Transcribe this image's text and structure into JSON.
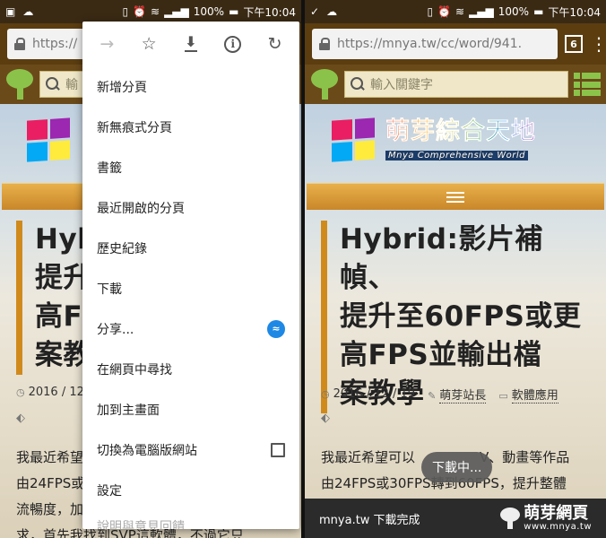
{
  "status_bar": {
    "battery": "100%",
    "time": "下午10:04"
  },
  "left": {
    "url_text": "https://",
    "search_placeholder": "輸",
    "article_title_lines": [
      "Hyb",
      "提升",
      "高F",
      "案教"
    ],
    "meta_date": "2016 / 12",
    "body_lines": [
      "我最近希望",
      "由24FPS或",
      "流暢度，加",
      "求，首先我找到SVP這軟體，不過它只"
    ],
    "menu": {
      "icons": [
        "forward-icon",
        "star-icon",
        "download-icon",
        "info-icon",
        "reload-icon"
      ],
      "items": [
        {
          "label": "新增分頁"
        },
        {
          "label": "新無痕式分頁"
        },
        {
          "label": "書籤"
        },
        {
          "label": "最近開啟的分頁"
        },
        {
          "label": "歷史紀錄"
        },
        {
          "label": "下載"
        },
        {
          "label": "分享..."
        },
        {
          "label": "在網頁中尋找"
        },
        {
          "label": "加到主畫面"
        },
        {
          "label": "切換為電腦版網站"
        },
        {
          "label": "設定"
        },
        {
          "label": "說明與意見回饋"
        }
      ]
    }
  },
  "right": {
    "url_text": "https://mnya.tw/cc/word/941.",
    "tab_count": "6",
    "search_placeholder": "輸入關鍵字",
    "site_title": "萌芽綜合天地",
    "site_subtitle": "Mnya Comprehensive World",
    "article_title_lines": [
      "Hybrid:影片補幀、",
      "提升至60FPS或更",
      "高FPS並輸出檔",
      "案教學"
    ],
    "meta_date": "2016 / 12 / 19",
    "meta_author": "萌芽站長",
    "meta_category": "軟體應用",
    "body_lines": [
      "我最近希望可以",
      "V、動畫等作品",
      "由24FPS或30FPS轉到60FPS，提升整體"
    ],
    "toast": "下載中...",
    "download_complete": "mnya.tw 下載完成",
    "watermark_name": "萌芽網頁",
    "watermark_url": "www.mnya.tw"
  },
  "colors": {
    "url_bar": "#5b3d10",
    "site_bar": "#6b4a1a",
    "accent_green": "#8bc34a",
    "title_border": "#d08a1c",
    "nav_band": "#e8b04a"
  }
}
